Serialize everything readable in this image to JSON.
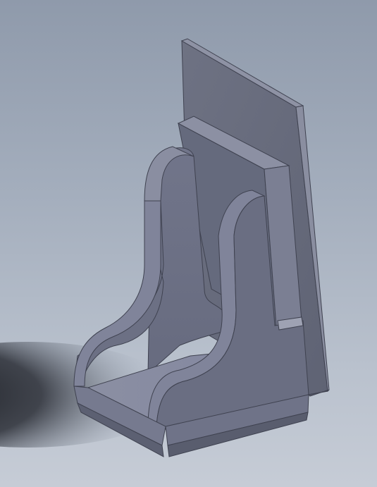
{
  "viewport": {
    "background_top": "#8f9aab",
    "background_bottom": "#c6ccd6"
  },
  "model": {
    "part_color_light": "#7e8294",
    "part_color_mid": "#6f7385",
    "part_color_dark": "#585c6c",
    "edge_color": "#3f4250",
    "shadow_color": "#1a1c22"
  }
}
